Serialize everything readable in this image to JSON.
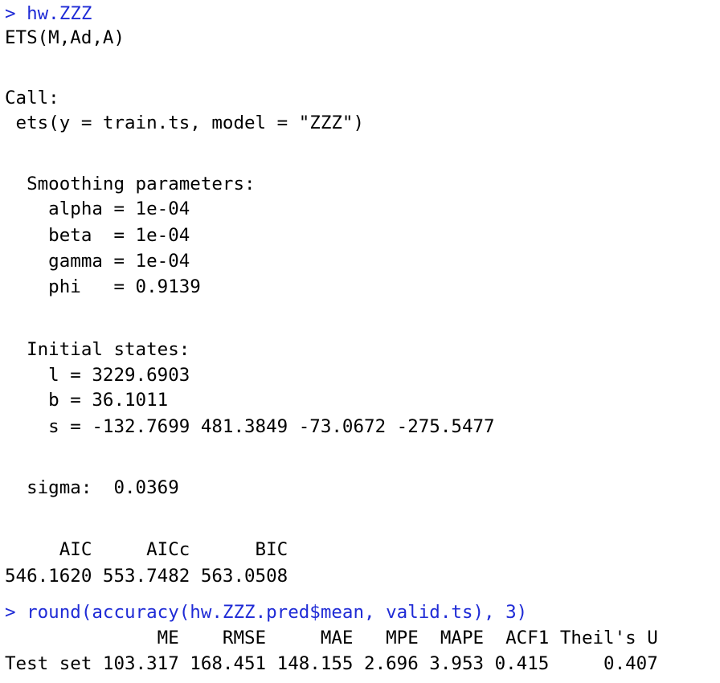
{
  "console": {
    "prompt": ">",
    "command_color": "#1f2bd6",
    "output_color": "#000000",
    "blocks": [
      {
        "kind": "command",
        "text": "hw.ZZZ"
      },
      {
        "kind": "output",
        "text": "ETS(M,Ad,A)"
      },
      {
        "kind": "output",
        "text": "Call:"
      },
      {
        "kind": "output",
        "text": " ets(y = train.ts, model = \"ZZZ\")"
      },
      {
        "kind": "output",
        "text": "  Smoothing parameters:"
      },
      {
        "kind": "output",
        "text": "    alpha = 1e-04"
      },
      {
        "kind": "output",
        "text": "    beta  = 1e-04"
      },
      {
        "kind": "output",
        "text": "    gamma = 1e-04"
      },
      {
        "kind": "output",
        "text": "    phi   = 0.9139"
      },
      {
        "kind": "output",
        "text": "  Initial states:"
      },
      {
        "kind": "output",
        "text": "    l = 3229.6903"
      },
      {
        "kind": "output",
        "text": "    b = 36.1011"
      },
      {
        "kind": "output",
        "text": "    s = -132.7699 481.3849 -73.0672 -275.5477"
      },
      {
        "kind": "output",
        "text": "  sigma:  0.0369"
      },
      {
        "kind": "output",
        "text": "     AIC     AICc      BIC"
      },
      {
        "kind": "output",
        "text": "546.1620 553.7482 563.0508"
      },
      {
        "kind": "command",
        "text": "round(accuracy(hw.ZZZ.pred$mean, valid.ts), 3)"
      },
      {
        "kind": "output",
        "text": "              ME    RMSE     MAE   MPE  MAPE  ACF1 Theil's U"
      },
      {
        "kind": "output",
        "text": "Test set 103.317 168.451 148.155 2.696 3.953 0.415     0.407"
      }
    ]
  }
}
